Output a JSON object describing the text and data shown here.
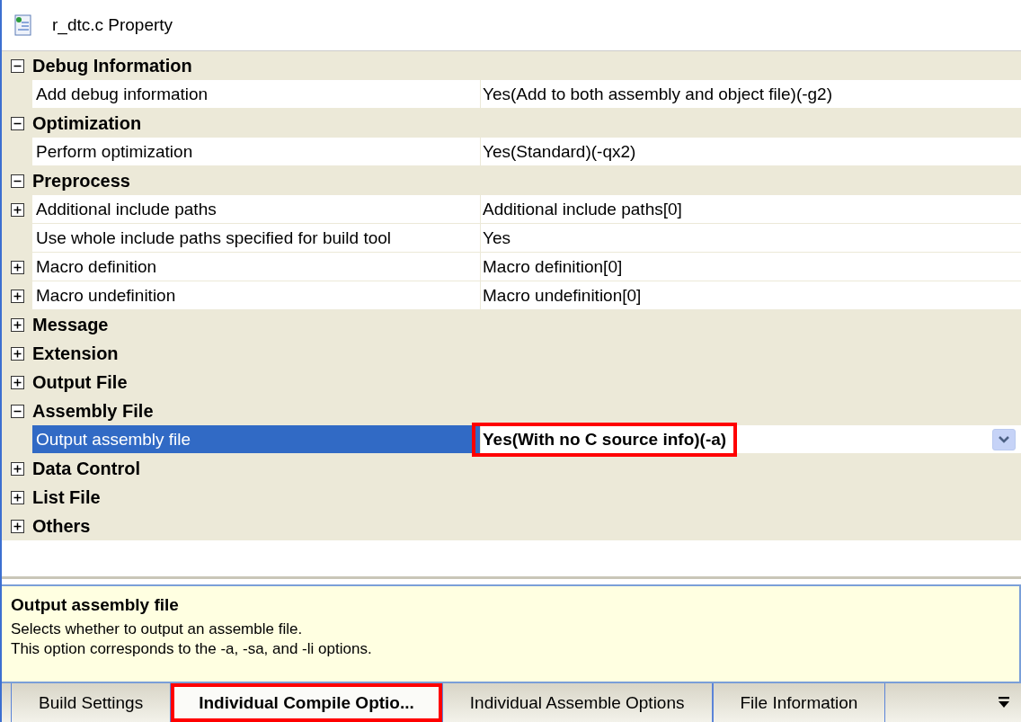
{
  "panel": {
    "title": "r_dtc.c Property"
  },
  "rows": [
    {
      "kind": "category",
      "label": "Debug Information",
      "expanded": true,
      "selected": false
    },
    {
      "kind": "property",
      "label": "Add debug information",
      "value": "Yes(Add to both assembly and object file)(-g2)",
      "selected": false
    },
    {
      "kind": "category",
      "label": "Optimization",
      "expanded": true,
      "selected": false
    },
    {
      "kind": "property",
      "label": "Perform optimization",
      "value": "Yes(Standard)(-qx2)",
      "selected": false
    },
    {
      "kind": "category",
      "label": "Preprocess",
      "expanded": true,
      "selected": false
    },
    {
      "kind": "property",
      "label": "Additional include paths",
      "value": "Additional include paths[0]",
      "expanded": false,
      "selected": false
    },
    {
      "kind": "property",
      "label": "Use whole include paths specified for build tool",
      "value": "Yes",
      "selected": false
    },
    {
      "kind": "property",
      "label": "Macro definition",
      "value": "Macro definition[0]",
      "expanded": false,
      "selected": false
    },
    {
      "kind": "property",
      "label": "Macro undefinition",
      "value": "Macro undefinition[0]",
      "expanded": false,
      "selected": false
    },
    {
      "kind": "category",
      "label": "Message",
      "expanded": false,
      "selected": false
    },
    {
      "kind": "category",
      "label": "Extension",
      "expanded": false,
      "selected": false
    },
    {
      "kind": "category",
      "label": "Output File",
      "expanded": false,
      "selected": false
    },
    {
      "kind": "category",
      "label": "Assembly File",
      "expanded": true,
      "selected": false
    },
    {
      "kind": "property",
      "label": "Output assembly file",
      "value": "Yes(With no C source info)(-a)",
      "selected": true,
      "highlighted": true
    },
    {
      "kind": "category",
      "label": "Data Control",
      "expanded": false,
      "selected": false
    },
    {
      "kind": "category",
      "label": "List File",
      "expanded": false,
      "selected": false
    },
    {
      "kind": "category",
      "label": "Others",
      "expanded": false,
      "selected": false
    }
  ],
  "description": {
    "title": "Output assembly file",
    "lines": [
      "Selects whether to output an assemble file.",
      "This option corresponds to the -a, -sa, and -li options."
    ]
  },
  "tabs": [
    {
      "label": "Build Settings",
      "selected": false,
      "highlighted": false
    },
    {
      "label": "Individual Compile Optio...",
      "selected": true,
      "highlighted": true
    },
    {
      "label": "Individual Assemble Options",
      "selected": false,
      "highlighted": false
    },
    {
      "label": "File Information",
      "selected": false,
      "highlighted": false
    }
  ]
}
